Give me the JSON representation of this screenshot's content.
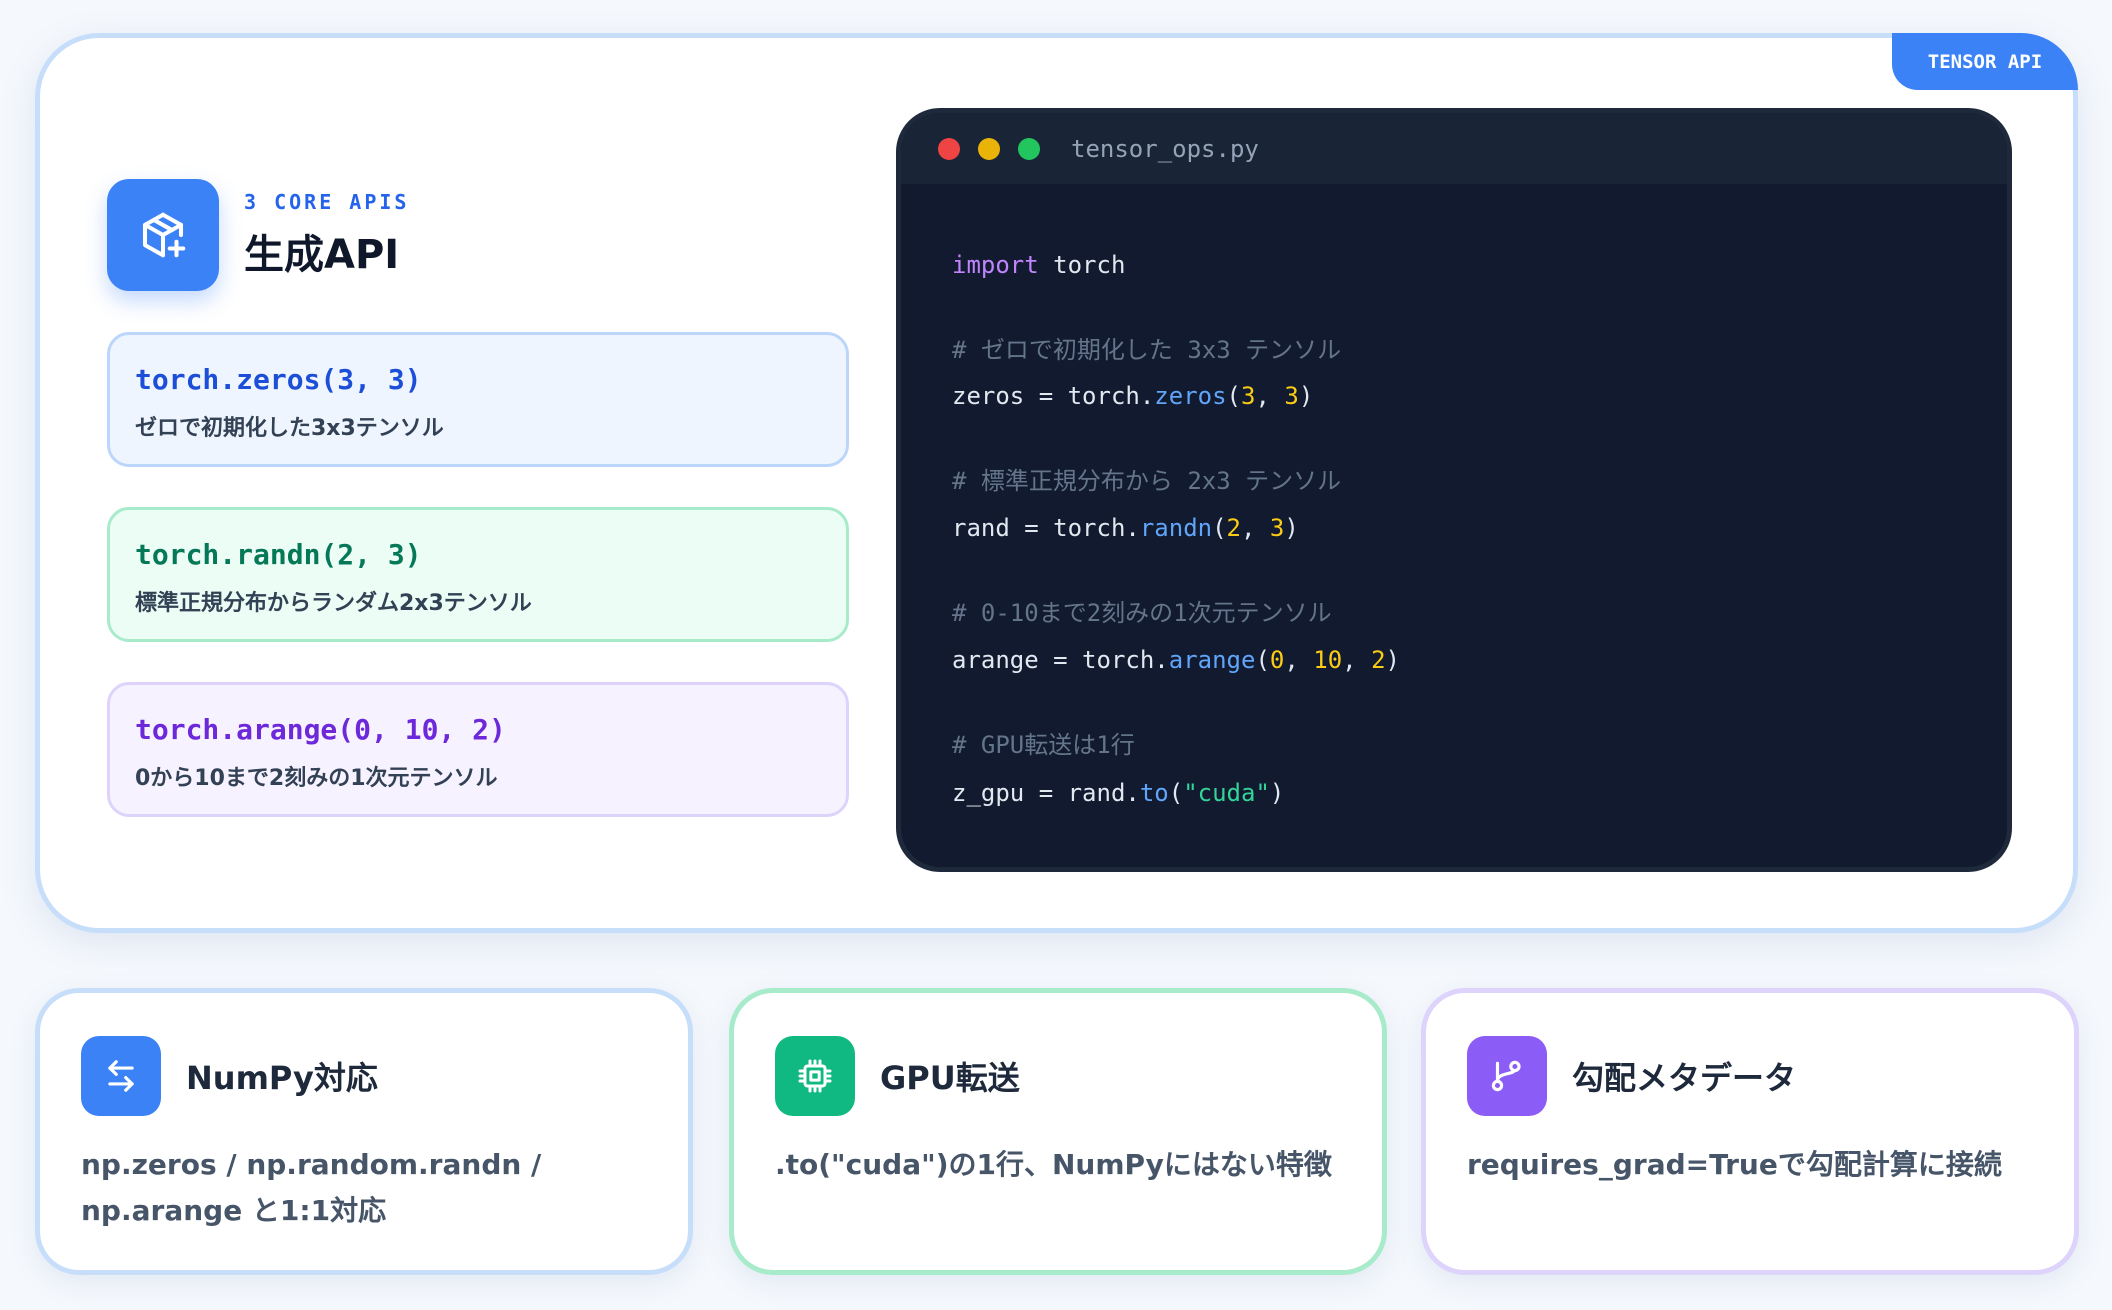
{
  "badge": "TENSOR API",
  "header": {
    "kicker": "3 CORE APIS",
    "title": "生成API",
    "icon": "cube-plus-icon"
  },
  "api_cards": [
    {
      "code": "torch.zeros(3, 3)",
      "desc": "ゼロで初期化した3x3テンソル",
      "color": "#1d4ed8"
    },
    {
      "code": "torch.randn(2, 3)",
      "desc": "標準正規分布からランダム2x3テンソル",
      "color": "#047857"
    },
    {
      "code": "torch.arange(0, 10, 2)",
      "desc": "0から10まで2刻みの1次元テンソル",
      "color": "#6d28d9"
    }
  ],
  "editor": {
    "filename": "tensor_ops.py",
    "code": {
      "l1_kw": "import",
      "l1_rest": " torch",
      "c1": "# ゼロで初期化した 3x3 テンソル",
      "l2_var": "zeros = torch.",
      "l2_fn": "zeros",
      "l2_n1": "3",
      "l2_n2": "3",
      "c2": "# 標準正規分布から 2x3 テンソル",
      "l3_var": "rand = torch.",
      "l3_fn": "randn",
      "l3_n1": "2",
      "l3_n2": "3",
      "c3": "# 0-10まで2刻みの1次元テンソル",
      "l4_var": "arange = torch.",
      "l4_fn": "arange",
      "l4_n1": "0",
      "l4_n2": "10",
      "l4_n3": "2",
      "c4": "# GPU転送は1行",
      "l5_var": "z_gpu = rand.",
      "l5_fn": "to",
      "l5_str": "\"cuda\""
    }
  },
  "features": [
    {
      "icon": "arrows-exchange-icon",
      "title": "NumPy対応",
      "desc": "np.zeros / np.random.randn / np.arange と1:1対応"
    },
    {
      "icon": "cpu-chip-icon",
      "title": "GPU転送",
      "desc": ".to(\"cuda\")の1行、NumPyにはない特徴"
    },
    {
      "icon": "git-branch-icon",
      "title": "勾配メタデータ",
      "desc": "requires_grad=Trueで勾配計算に接続"
    }
  ]
}
